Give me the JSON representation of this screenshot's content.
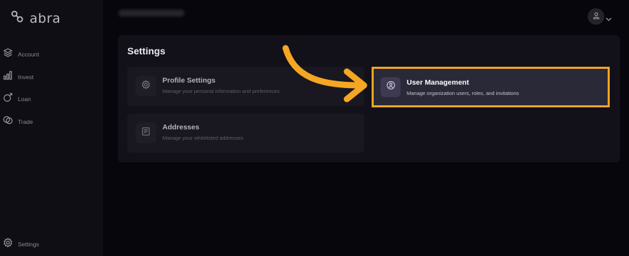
{
  "brand": {
    "name": "abra",
    "logo_icon": "abra-logo-icon"
  },
  "sidebar": {
    "items": [
      {
        "label": "Account",
        "icon": "account-icon"
      },
      {
        "label": "Invest",
        "icon": "invest-chart-icon"
      },
      {
        "label": "Loan",
        "icon": "loan-icon"
      },
      {
        "label": "Trade",
        "icon": "trade-icon"
      }
    ],
    "settings": {
      "label": "Settings",
      "icon": "gear-icon"
    }
  },
  "header": {
    "user_icon": "user-icon",
    "menu_icon": "chevron-down-icon"
  },
  "settings": {
    "title": "Settings",
    "cards": [
      {
        "title": "Profile Settings",
        "description": "Manage your personal information and preferences",
        "icon": "gear-icon"
      },
      {
        "title": "User Management",
        "description": "Manage organization users, roles, and invitations",
        "icon": "user-badge-icon"
      },
      {
        "title": "Addresses",
        "description": "Manage your whitelisted addresses",
        "icon": "address-book-icon"
      }
    ]
  },
  "annotation": {
    "arrow_color": "#f5a623",
    "highlight_color": "#f5a623"
  }
}
